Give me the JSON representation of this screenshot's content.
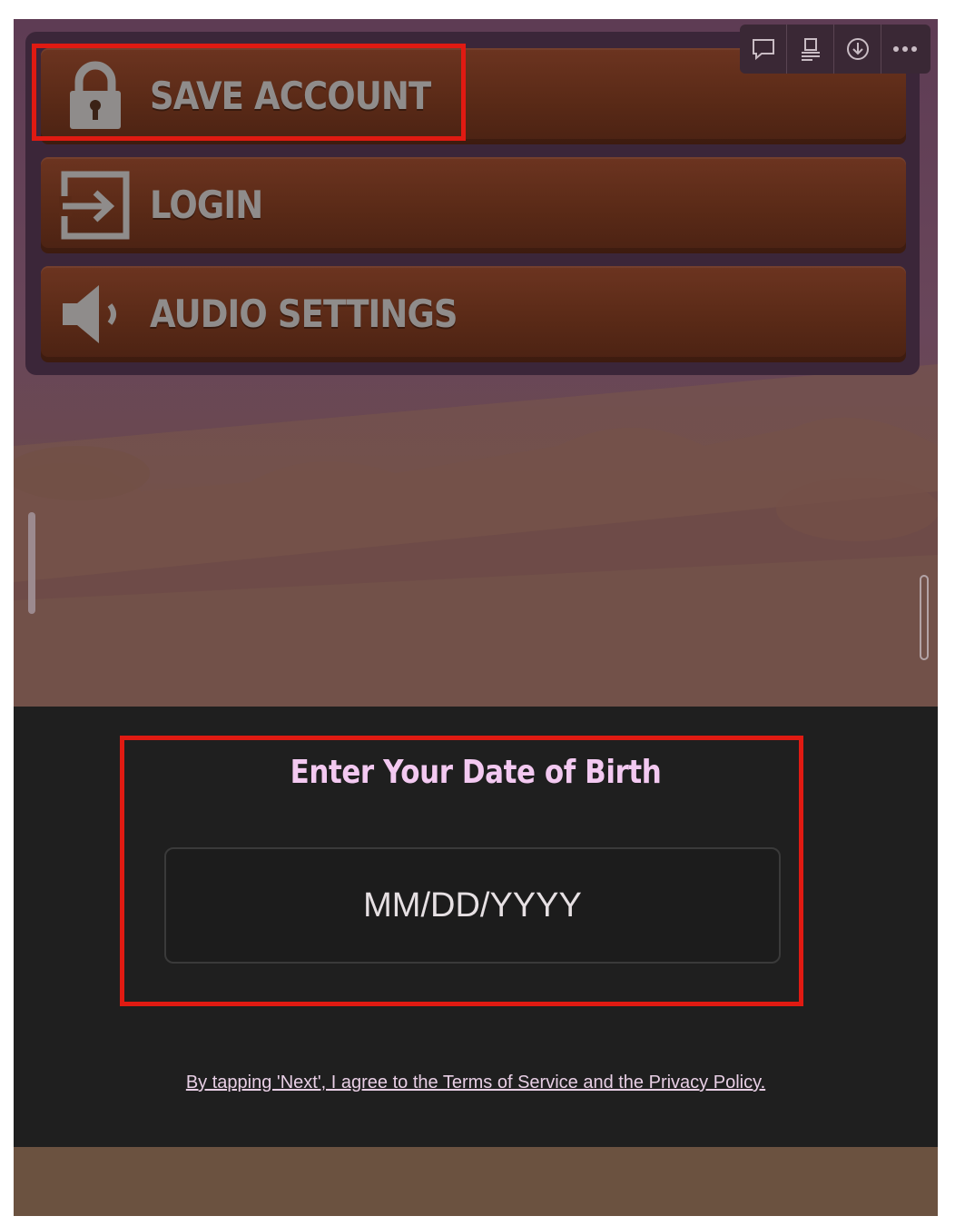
{
  "menu": {
    "items": [
      {
        "label": "SAVE ACCOUNT",
        "icon": "lock-icon"
      },
      {
        "label": "LOGIN",
        "icon": "login-icon"
      },
      {
        "label": "AUDIO SETTINGS",
        "icon": "speaker-icon"
      }
    ]
  },
  "toolbar": {
    "icons": [
      "comment-icon",
      "pin-icon",
      "download-icon",
      "more-icon"
    ]
  },
  "dialog": {
    "title": "Enter Your Date of Birth",
    "input_placeholder": "MM/DD/YYYY",
    "terms_text": "By tapping 'Next', I agree to the Terms of Service and the Privacy Policy."
  },
  "colors": {
    "highlight": "#e01a12",
    "title_text": "#f3c9f1",
    "button_brown": "#5a2a17",
    "dialog_bg": "#1f1f1f"
  }
}
